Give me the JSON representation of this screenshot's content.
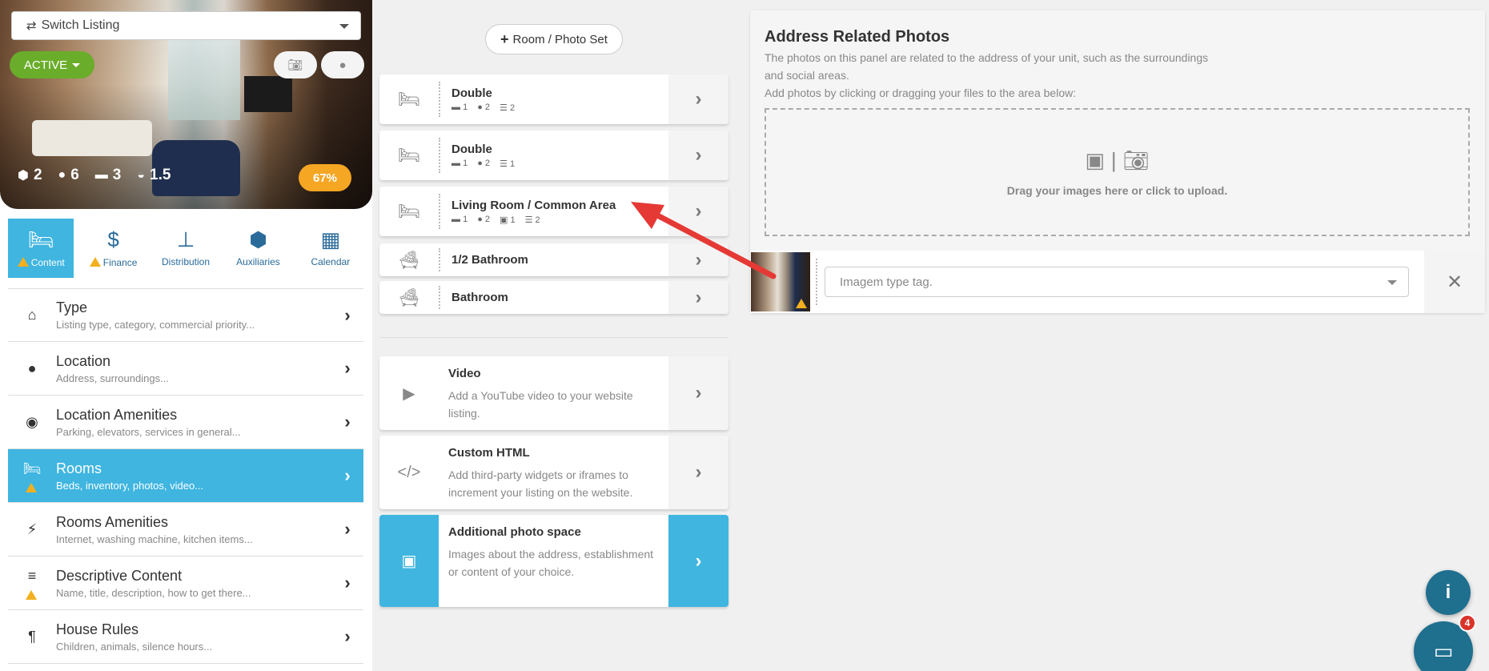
{
  "listing": {
    "switch_label": "Switch Listing",
    "status": "ACTIVE",
    "stats": {
      "units": "2",
      "guests": "6",
      "beds": "3",
      "baths": "1.5"
    },
    "completion": "67%",
    "completion_value": 0.67
  },
  "tabs": [
    {
      "label": "Content",
      "icon": "bed-icon",
      "warning": true,
      "active": true
    },
    {
      "label": "Finance",
      "icon": "dollar-icon",
      "warning": true,
      "active": false
    },
    {
      "label": "Distribution",
      "icon": "sitemap-icon",
      "warning": false,
      "active": false
    },
    {
      "label": "Auxiliaries",
      "icon": "cubes-icon",
      "warning": false,
      "active": false
    },
    {
      "label": "Calendar",
      "icon": "calendar-icon",
      "warning": false,
      "active": false
    }
  ],
  "menu": [
    {
      "title": "Type",
      "subtitle": "Listing type, category, commercial priority...",
      "icon": "home-icon"
    },
    {
      "title": "Location",
      "subtitle": "Address, surroundings...",
      "icon": "map-pin-icon"
    },
    {
      "title": "Location Amenities",
      "subtitle": "Parking, elevators, services in general...",
      "icon": "target-icon"
    },
    {
      "title": "Rooms",
      "subtitle": "Beds, inventory, photos, video...",
      "icon": "bed-icon",
      "active": true,
      "warning": true
    },
    {
      "title": "Rooms Amenities",
      "subtitle": "Internet, washing machine, kitchen items...",
      "icon": "plug-icon"
    },
    {
      "title": "Descriptive Content",
      "subtitle": "Name, title, description, how to get there...",
      "icon": "align-left-icon",
      "warning": true
    },
    {
      "title": "House Rules",
      "subtitle": "Children, animals, silence hours...",
      "icon": "paragraph-icon"
    }
  ],
  "add_room_label": "Room / Photo Set",
  "rooms": [
    {
      "title": "Double",
      "icon": "bed-icon",
      "meta": [
        "1",
        "2",
        "2"
      ]
    },
    {
      "title": "Double",
      "icon": "bed-icon",
      "meta": [
        "1",
        "2",
        "1"
      ]
    },
    {
      "title": "Living Room / Common Area",
      "icon": "bed-icon",
      "meta": [
        "1",
        "2",
        "1",
        "2"
      ]
    },
    {
      "title": "1/2 Bathroom",
      "icon": "bath-icon",
      "meta": []
    },
    {
      "title": "Bathroom",
      "icon": "bath-icon",
      "meta": []
    }
  ],
  "extras": [
    {
      "title": "Video",
      "desc": "Add a YouTube video to your website listing.",
      "icon": "youtube-icon"
    },
    {
      "title": "Custom HTML",
      "desc": "Add third-party widgets or iframes to increment your listing on the website.",
      "icon": "code-icon"
    },
    {
      "title": "Additional photo space",
      "desc": "Images about the address, establishment or content of your choice.",
      "icon": "image-icon",
      "active": true
    }
  ],
  "panel": {
    "title": "Address Related Photos",
    "desc1": "The photos on this panel are related to the address of your unit, such as the surroundings and social areas.",
    "desc2": "Add photos by clicking or dragging your files to the area below:",
    "dropzone_text": "Drag your images here or click to upload.",
    "tag_placeholder": "Imagem type tag."
  },
  "chat_badge": "4",
  "colors": {
    "accent": "#3fb5e0",
    "active_green": "#6aad2a",
    "warning": "#f2b01e",
    "progress": "#f5a623",
    "fab": "#1f6f8f"
  }
}
